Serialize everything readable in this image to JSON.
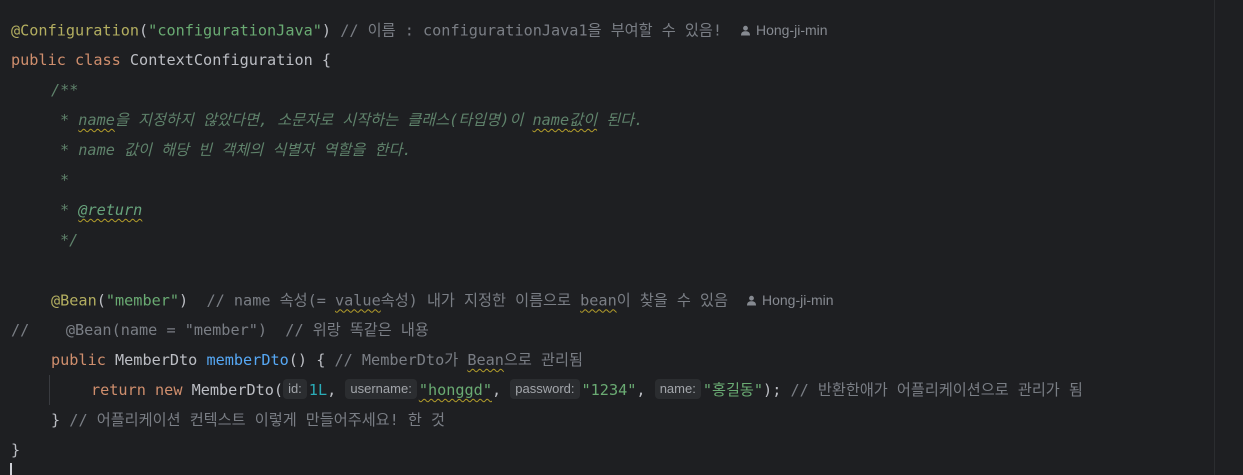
{
  "code": {
    "l1": {
      "annotation": "@Configuration",
      "paren_open": "(",
      "string": "\"configurationJava\"",
      "paren_close": ")",
      "comment": " // 이름 : configurationJava1을 부여할 수 있음!",
      "author": "Hong-ji-min"
    },
    "l2": {
      "kw1": "public",
      "kw2": "class",
      "name": "ContextConfiguration {"
    },
    "l3": {
      "text": "/**"
    },
    "l4": {
      "star": "* ",
      "name": "name",
      "text1": "을 지정하지 않았다면, 소문자로 시작하는 클래스(타입명)이 ",
      "name2": "name",
      "text2": "값이",
      "text3": " 된다."
    },
    "l5": {
      "text": "* name 값이 해당 빈 객체의 식별자 역할을 한다."
    },
    "l6": {
      "text": "*"
    },
    "l7": {
      "star": "* ",
      "tag": "@return"
    },
    "l8": {
      "text": "*/"
    },
    "l9": {
      "annotation": "@Bean",
      "paren_open": "(",
      "string": "\"member\"",
      "paren_close": ")",
      "comment1": "  // name 속성(= ",
      "comment2": "value",
      "comment3": "속성) 내가 지정한 이름으로 ",
      "comment4": "bean",
      "comment5": "이 찾을 수 있음",
      "author": "Hong-ji-min"
    },
    "l10": {
      "text": "//    @Bean(name = \"member\")  // 위랑 똑같은 내용"
    },
    "l11": {
      "kw": "public",
      "type": " MemberDto ",
      "method": "memberDto",
      "rest": "() { ",
      "comment1": "// MemberDto가 ",
      "comment2": "Bean",
      "comment3": "으로 관리됨"
    },
    "l12": {
      "kw1": "return",
      "kw2": "new",
      "ctor": " MemberDto(",
      "hint_id": "id:",
      "id_val": "1L",
      "sep1": ", ",
      "hint_username": "username:",
      "username_val": "\"honggd\"",
      "sep2": ", ",
      "hint_password": "password:",
      "password_val": "\"1234\"",
      "sep3": ", ",
      "hint_name": "name:",
      "name_val": "\"홍길동\"",
      "end": "); ",
      "comment": "// 반환한애가 어플리케이션으로 관리가 됨"
    },
    "l13": {
      "brace": "}",
      "comment": " // 어플리케이션 컨텍스트 이렇게 만들어주세요! 한 것"
    },
    "l14": {
      "brace": "}"
    }
  },
  "icons": {
    "author": "person-icon"
  },
  "colors": {
    "background": "#1e1f22",
    "annotation": "#b3ae60",
    "string": "#6aab73",
    "keyword": "#cf8e6d",
    "comment": "#7a7e85",
    "doc_comment": "#5f826b",
    "method": "#56a8f5",
    "number": "#2aacb8"
  }
}
